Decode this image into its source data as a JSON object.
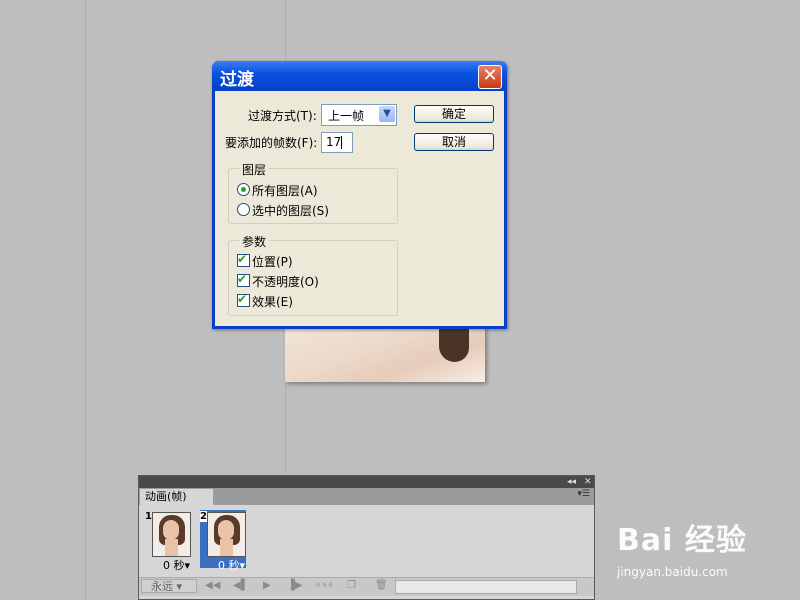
{
  "dialog": {
    "title": "过渡",
    "transition_label": "过渡方式(T):",
    "transition_value": "上一帧",
    "frames_label": "要添加的帧数(F):",
    "frames_value": "17",
    "ok_label": "确定",
    "cancel_label": "取消",
    "layers_group": {
      "title": "图层",
      "options": [
        "所有图层(A)",
        "选中的图层(S)"
      ],
      "selected": "所有图层(A)"
    },
    "params_group": {
      "title": "参数",
      "checks": [
        {
          "label": "位置(P)",
          "checked": true
        },
        {
          "label": "不透明度(O)",
          "checked": true
        },
        {
          "label": "效果(E)",
          "checked": true
        }
      ]
    }
  },
  "panel": {
    "tab_label": "动画(帧)",
    "frames": [
      {
        "number": "1",
        "time": "0 秒▾",
        "selected": false
      },
      {
        "number": "2",
        "time": "0 秒▾",
        "selected": true
      }
    ],
    "loop_label": "永远"
  },
  "watermark": {
    "logo": "Bai 经验",
    "url": "jingyan.baidu.com"
  },
  "colors": {
    "background": "#bebebe",
    "dialog_title": "#0a52e3",
    "selected_frame": "#3a6fc4",
    "check_green": "#21a121"
  }
}
